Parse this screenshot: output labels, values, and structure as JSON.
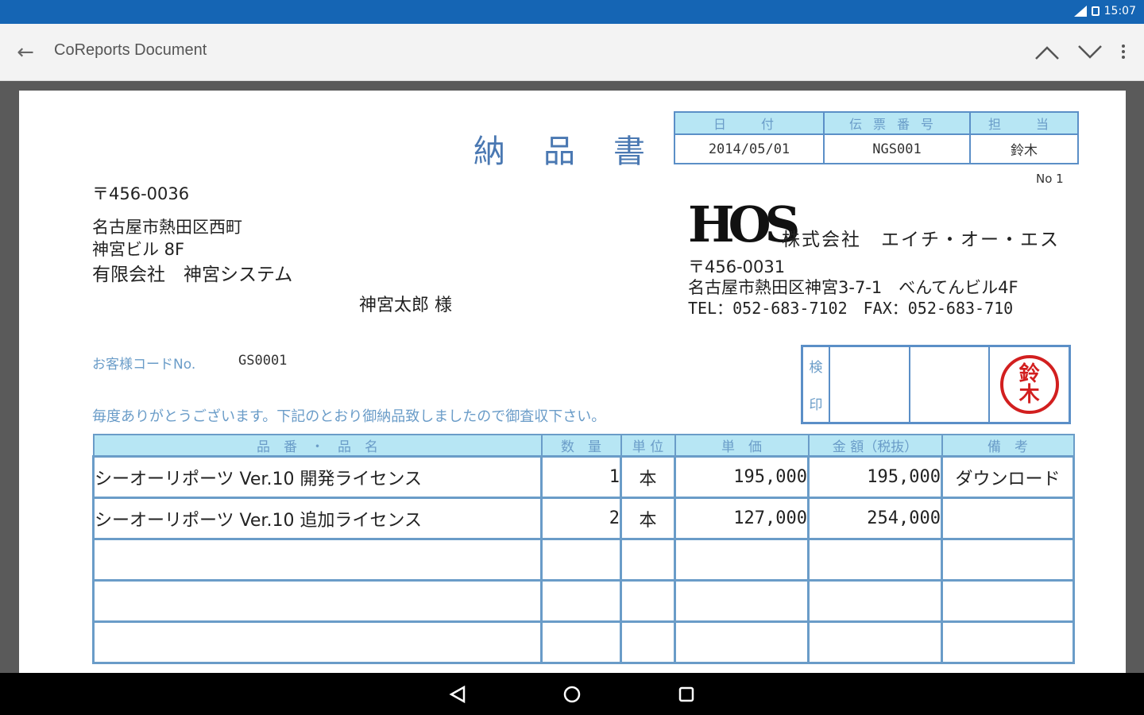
{
  "status_bar": {
    "time": "15:07",
    "bg_color": "#1565b4"
  },
  "app_bar": {
    "title": "CoReports Document",
    "back_icon": "arrow-left-icon",
    "prev_icon": "chevron-up-icon",
    "next_icon": "chevron-down-icon",
    "menu_icon": "more-vert-icon"
  },
  "document": {
    "title": "納品書",
    "header_table": {
      "columns": [
        "日　付",
        "伝票番号",
        "担　当"
      ],
      "values": [
        "2014/05/01",
        "NGS001",
        "鈴木"
      ]
    },
    "page_no": "No 1",
    "customer": {
      "postal": "〒456-0036",
      "address1": "名古屋市熱田区西町",
      "address2": "神宮ビル 8F",
      "company": "有限会社　神宮システム",
      "person": "神宮太郎 様"
    },
    "issuer": {
      "logo": "HOS",
      "company": "株式会社　エイチ・オー・エス",
      "postal": "〒456-0031",
      "address": "名古屋市熱田区神宮3-7-1　べんてんビル4F",
      "tel_fax": "TEL：052-683-7102　FAX：052-683-710"
    },
    "customer_code_label": "お客様コードNo.",
    "customer_code": "GS0001",
    "greeting": "毎度ありがとうございます。下記のとおり御納品致しましたので御査収下さい。",
    "stamp": {
      "label_top": "検",
      "label_bottom": "印",
      "seal_text_top": "鈴",
      "seal_text_bottom": "木",
      "seal_color": "#d21f1f"
    },
    "items_table": {
      "headers": [
        "品　番　・　品　名",
        "数　量",
        "単 位",
        "単　価",
        "金 額（税抜）",
        "備　考"
      ],
      "rows": [
        [
          "シーオーリポーツ Ver.10 開発ライセンス",
          "1",
          "本",
          "195,000",
          "195,000",
          "ダウンロード"
        ],
        [
          "シーオーリポーツ Ver.10 追加ライセンス",
          "2",
          "本",
          "127,000",
          "254,000",
          ""
        ],
        [
          "",
          "",
          "",
          "",
          "",
          ""
        ],
        [
          "",
          "",
          "",
          "",
          "",
          ""
        ],
        [
          "",
          "",
          "",
          "",
          "",
          ""
        ]
      ]
    },
    "accent_color": "#5b8fc7",
    "header_fill_color": "#b7e6f4"
  }
}
